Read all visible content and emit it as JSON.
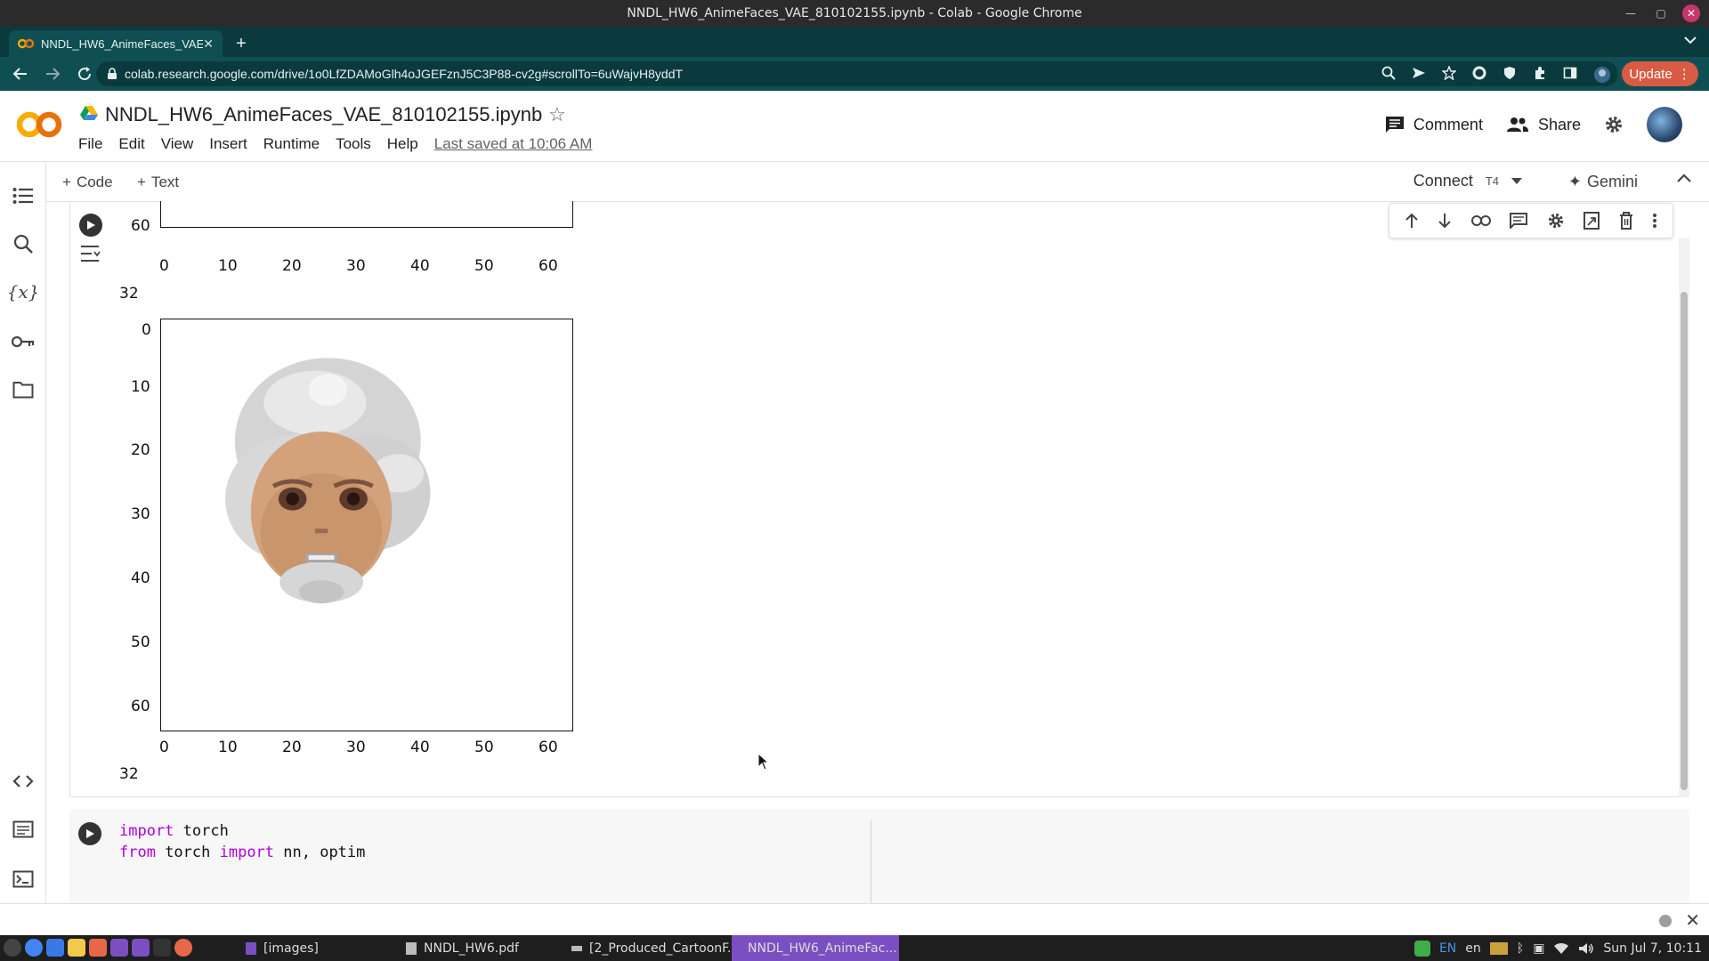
{
  "window": {
    "title": "NNDL_HW6_AnimeFaces_VAE_810102155.ipynb - Colab - Google Chrome"
  },
  "browser": {
    "tab_title": "NNDL_HW6_AnimeFaces_VAE",
    "url": "colab.research.google.com/drive/1o0LfZDAMoGlh4oJGEFznJ5C3P88-cv2g#scrollTo=6uWajvH8yddT",
    "update_label": "Update"
  },
  "colab": {
    "logo": "CO",
    "notebook_title": "NNDL_HW6_AnimeFaces_VAE_810102155.ipynb",
    "menu": [
      "File",
      "Edit",
      "View",
      "Insert",
      "Runtime",
      "Tools",
      "Help"
    ],
    "last_saved": "Last saved at 10:06 AM",
    "comment_label": "Comment",
    "share_label": "Share",
    "add_code_label": "Code",
    "add_text_label": "Text",
    "connect_label": "Connect",
    "gpu_label": "T4",
    "gemini_label": "Gemini"
  },
  "output": {
    "top_plot": {
      "ytick": "60",
      "xticks": [
        "0",
        "10",
        "20",
        "30",
        "40",
        "50",
        "60"
      ],
      "caption": "32"
    },
    "main_plot": {
      "yticks": [
        "0",
        "10",
        "20",
        "30",
        "40",
        "50",
        "60"
      ],
      "xticks": [
        "0",
        "10",
        "20",
        "30",
        "40",
        "50",
        "60"
      ],
      "caption": "32"
    }
  },
  "code_cell": {
    "line1": {
      "kw": "import",
      "rest": " torch"
    },
    "line2": {
      "kw1": "from",
      "mid": " torch ",
      "kw2": "import",
      "rest": " nn, optim"
    }
  },
  "taskbar": {
    "windows": [
      {
        "label": "[images]"
      },
      {
        "label": "NNDL_HW6.pdf"
      },
      {
        "label": "[2_Produced_CartoonF..."
      },
      {
        "label": "NNDL_HW6_AnimeFac..."
      }
    ],
    "lang": "EN",
    "lang2": "en",
    "clock": "Sun Jul 7, 10:11"
  },
  "colors": {
    "browser_chrome": "#0f4f54",
    "update_button": "#d95b43",
    "colab_orange": "#f9ab00",
    "keyword": "#af00db",
    "active_taskbar": "#7b4fc2"
  }
}
